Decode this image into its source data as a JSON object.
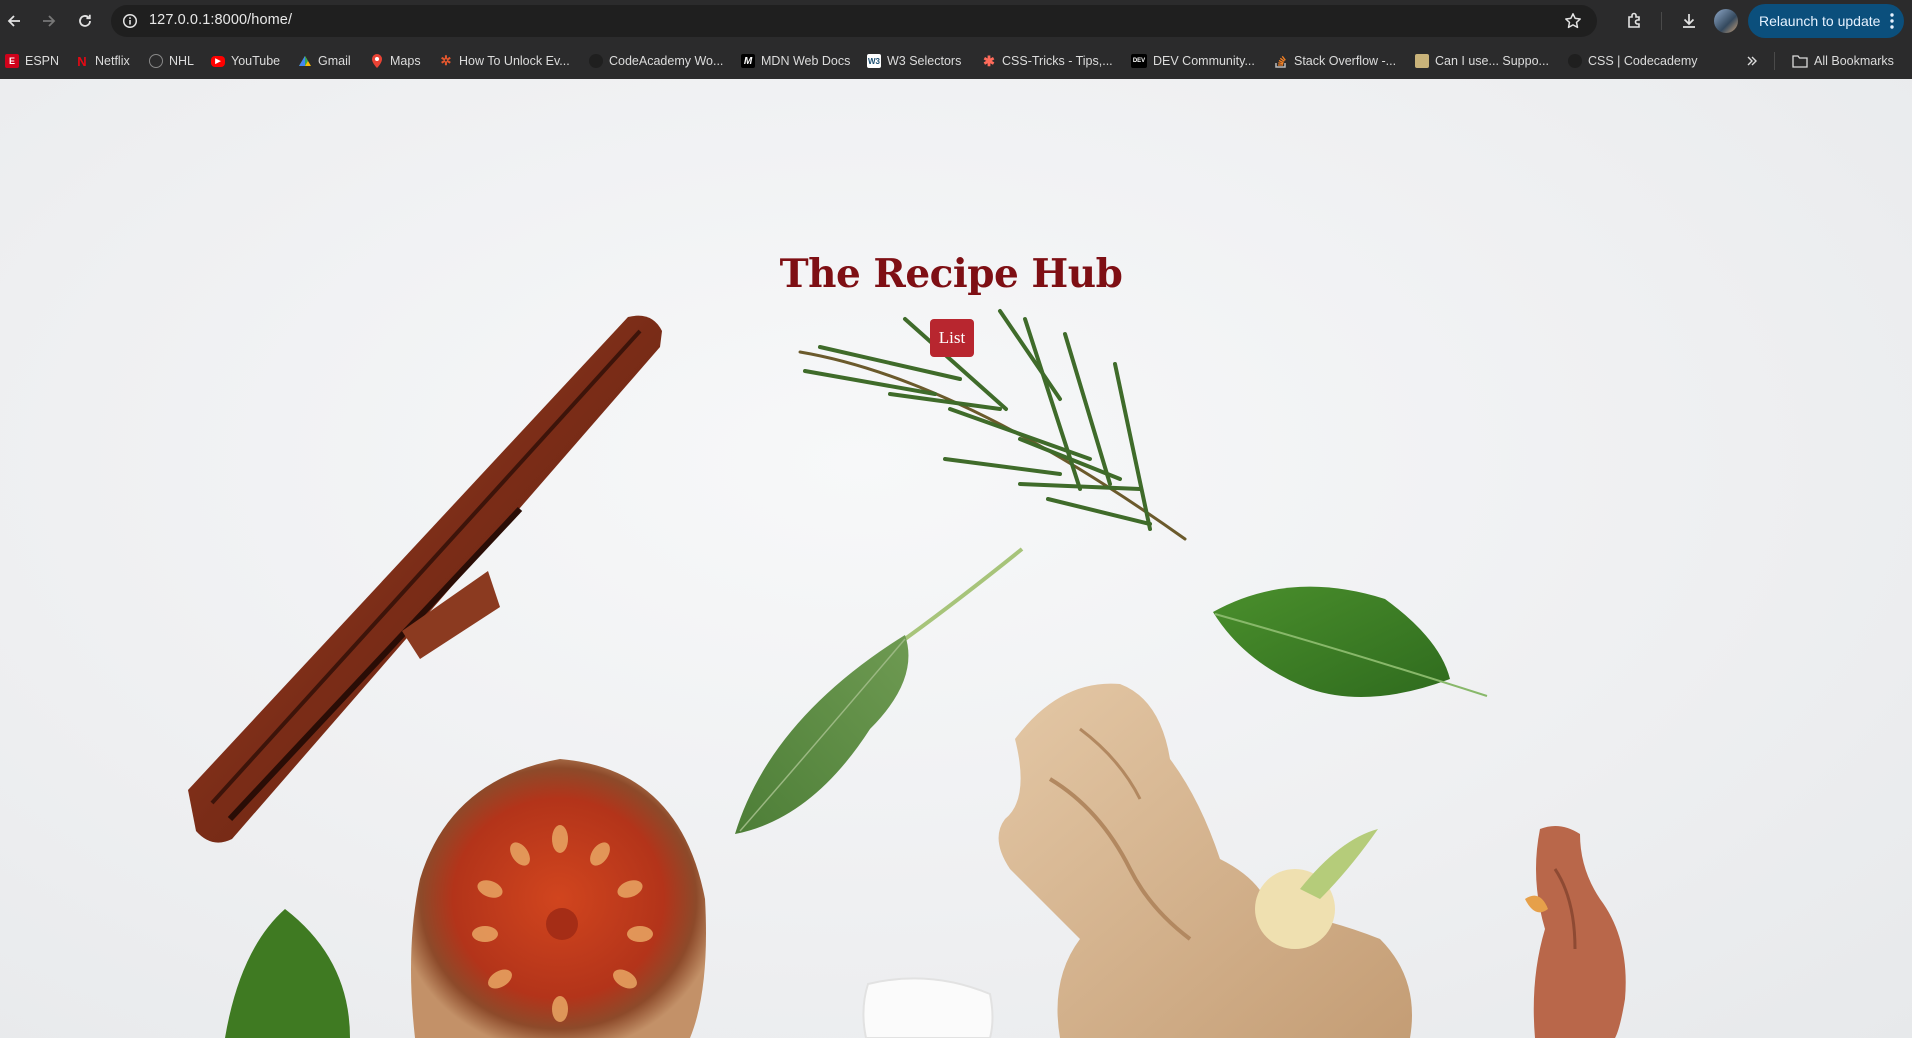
{
  "browser": {
    "url": "127.0.0.1:8000/home/",
    "relaunch_label": "Relaunch to update",
    "bookmarks": [
      {
        "label": "ESPN",
        "icon": "espn-icon"
      },
      {
        "label": "Netflix",
        "icon": "netflix-icon"
      },
      {
        "label": "NHL",
        "icon": "nhl-icon"
      },
      {
        "label": "YouTube",
        "icon": "youtube-icon"
      },
      {
        "label": "Gmail",
        "icon": "gmail-icon"
      },
      {
        "label": "Maps",
        "icon": "maps-icon"
      },
      {
        "label": "How To Unlock Ev...",
        "icon": "gear-favicon-icon"
      },
      {
        "label": "CodeAcademy Wo...",
        "icon": "codecademy-icon"
      },
      {
        "label": "MDN Web Docs",
        "icon": "mdn-icon"
      },
      {
        "label": "W3 Selectors",
        "icon": "w3schools-icon"
      },
      {
        "label": "CSS-Tricks - Tips,...",
        "icon": "css-tricks-icon"
      },
      {
        "label": "DEV Community...",
        "icon": "dev-icon"
      },
      {
        "label": "Stack Overflow -...",
        "icon": "stackoverflow-icon"
      },
      {
        "label": "Can I use... Suppo...",
        "icon": "caniuse-icon"
      },
      {
        "label": "CSS | Codecademy",
        "icon": "codecademy-icon"
      }
    ],
    "all_bookmarks_label": "All Bookmarks"
  },
  "page": {
    "title": "The Recipe Hub",
    "list_button": "List",
    "background": "spices-and-herbs-photo"
  },
  "colors": {
    "title": "#7e0f14",
    "button": "#b8262f",
    "relaunch": "#0b4f7c"
  }
}
